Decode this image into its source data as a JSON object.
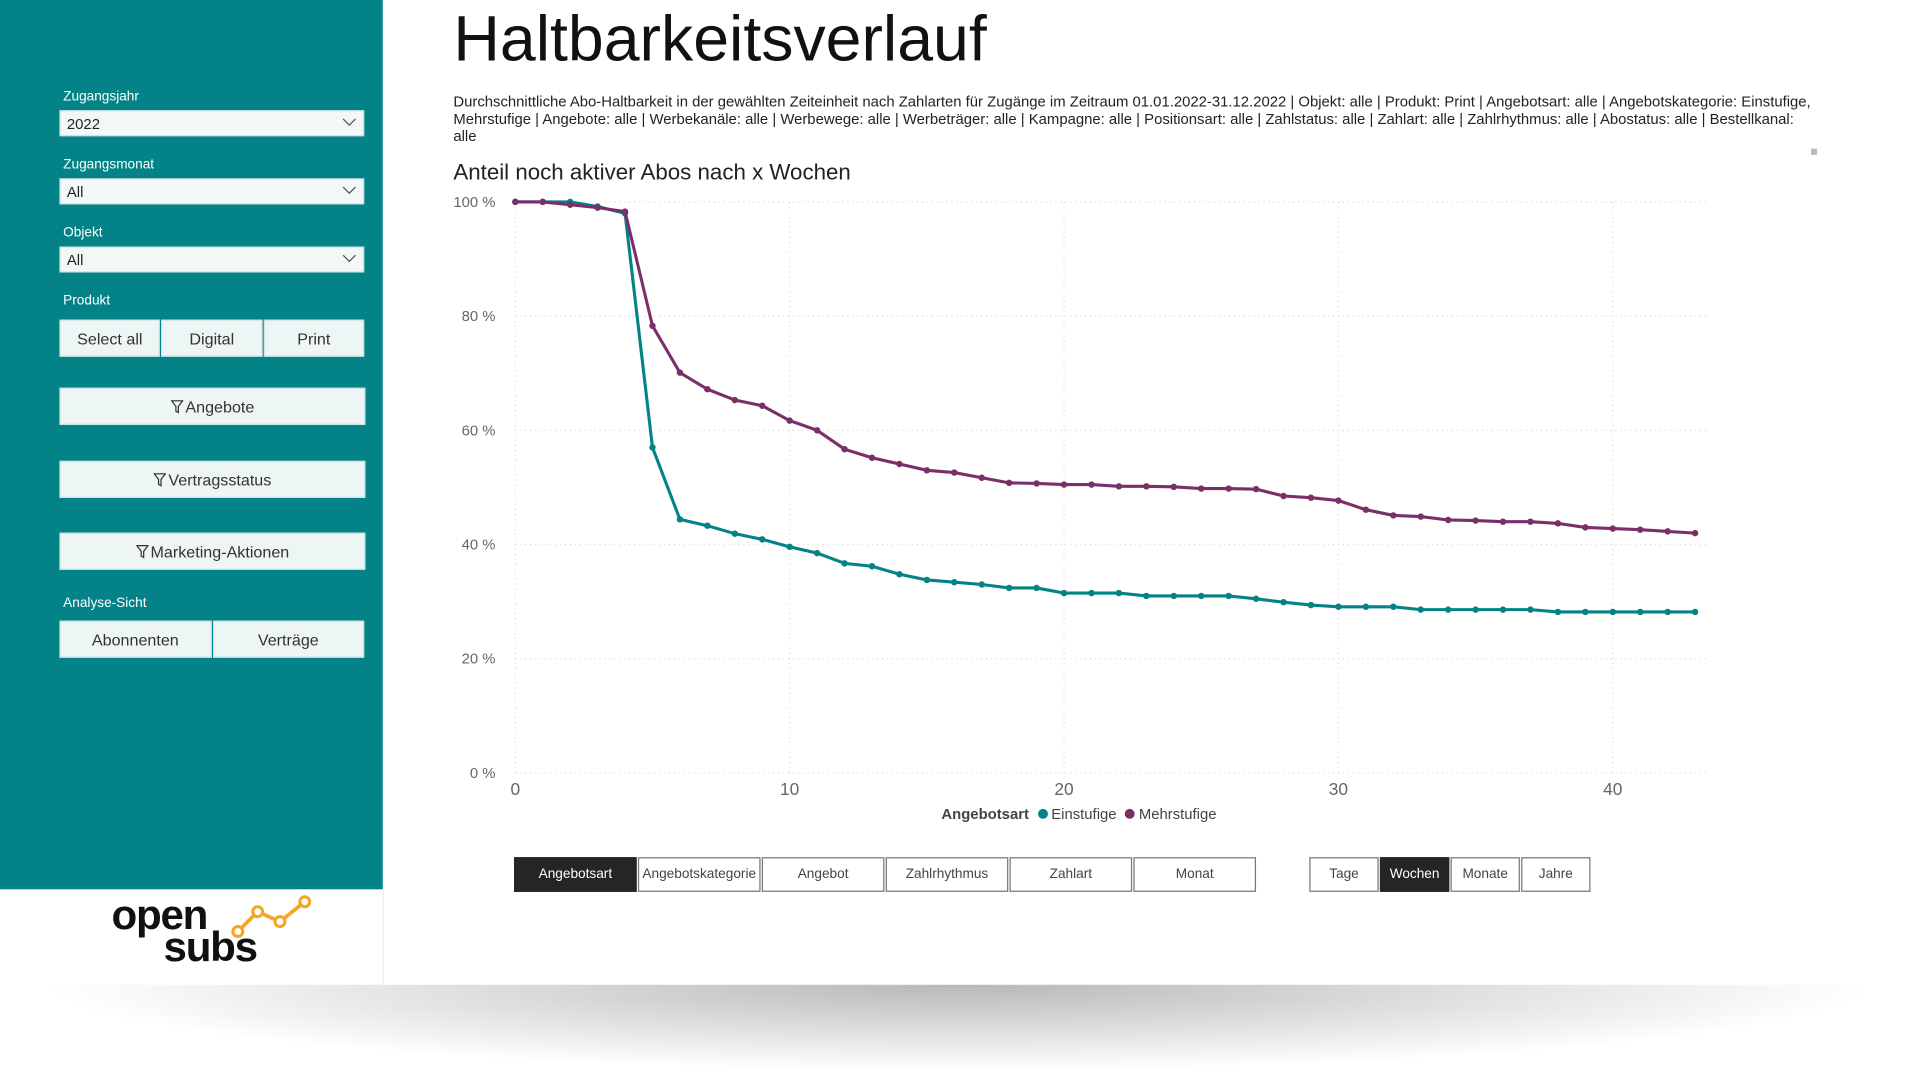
{
  "sidebar": {
    "year": {
      "label": "Zugangsjahr",
      "value": "2022"
    },
    "month": {
      "label": "Zugangsmonat",
      "value": "All"
    },
    "object": {
      "label": "Objekt",
      "value": "All"
    },
    "product": {
      "label": "Produkt",
      "options": [
        "Select all",
        "Digital",
        "Print"
      ]
    },
    "filters": [
      "Angebote",
      "Vertragsstatus",
      "Marketing-Aktionen"
    ],
    "view": {
      "label": "Analyse-Sicht",
      "options": [
        "Abonnenten",
        "Verträge"
      ]
    },
    "logo": {
      "line1": "open",
      "line2": "subs"
    }
  },
  "colors": {
    "sidebar": "#038387",
    "einstufige": "#038387",
    "mehrstufige": "#7b2f68",
    "active_tab": "#252525",
    "logo_accent": "#f5a623"
  },
  "header": {
    "title": "Haltbarkeitsverlauf",
    "description": "Durchschnittliche Abo-Haltbarkeit in der gewählten Zeiteinheit nach Zahlarten für Zugänge im Zeitraum 01.01.2022-31.12.2022 | Objekt: alle | Produkt: Print | Angebotsart: alle | Angebotskategorie: Einstufige, Mehrstufige | Angebote: alle | Werbekanäle: alle | Werbewege: alle | Werbeträger: alle | Kampagne: alle | Positionsart: alle | Zahlstatus: alle | Zahlart: alle | Zahlrhythmus: alle | Abostatus: alle | Bestellkanal: alle"
  },
  "chart_data": {
    "type": "line",
    "title": "Anteil noch aktiver Abos nach x Wochen",
    "xlabel": "",
    "ylabel": "",
    "xlim": [
      0,
      43
    ],
    "ylim": [
      0,
      100
    ],
    "xticks": [
      "0",
      "10",
      "20",
      "30",
      "40"
    ],
    "yticks": [
      "0 %",
      "20 %",
      "40 %",
      "60 %",
      "80 %",
      "100 %"
    ],
    "grid": true,
    "legend": {
      "title": "Angebotsart",
      "placement": "bottom"
    },
    "x": [
      0,
      1,
      2,
      3,
      4,
      5,
      6,
      7,
      8,
      9,
      10,
      11,
      12,
      13,
      14,
      15,
      16,
      17,
      18,
      19,
      20,
      21,
      22,
      23,
      24,
      25,
      26,
      27,
      28,
      29,
      30,
      31,
      32,
      33,
      34,
      35,
      36,
      37,
      38,
      39,
      40,
      41,
      42,
      43
    ],
    "series": [
      {
        "name": "Einstufige",
        "values": [
          100,
          100,
          100,
          99.2,
          98,
          57,
          44.4,
          43.3,
          41.9,
          40.9,
          39.6,
          38.5,
          36.7,
          36.2,
          34.8,
          33.8,
          33.4,
          33,
          32.4,
          32.4,
          31.5,
          31.5,
          31.5,
          31,
          31,
          31,
          31,
          30.5,
          29.9,
          29.4,
          29.1,
          29.1,
          29.1,
          28.6,
          28.6,
          28.6,
          28.6,
          28.6,
          28.2,
          28.2,
          28.2,
          28.2,
          28.2,
          28.2
        ]
      },
      {
        "name": "Mehrstufige",
        "values": [
          100,
          100,
          99.5,
          99,
          98.3,
          78.3,
          70.1,
          67.2,
          65.3,
          64.3,
          61.7,
          60,
          56.7,
          55.2,
          54.1,
          53,
          52.6,
          51.7,
          50.8,
          50.7,
          50.5,
          50.5,
          50.2,
          50.2,
          50.1,
          49.8,
          49.8,
          49.7,
          48.5,
          48.2,
          47.7,
          46.1,
          45.1,
          44.9,
          44.3,
          44.2,
          44,
          44,
          43.7,
          43,
          42.8,
          42.6,
          42.3,
          42
        ]
      }
    ]
  },
  "dimension_tabs": {
    "items": [
      "Angebotsart",
      "Angebotskategorie",
      "Angebot",
      "Zahlrhythmus",
      "Zahlart",
      "Monat"
    ],
    "active": "Angebotsart"
  },
  "time_tabs": {
    "items": [
      "Tage",
      "Wochen",
      "Monate",
      "Jahre"
    ],
    "active": "Wochen"
  }
}
